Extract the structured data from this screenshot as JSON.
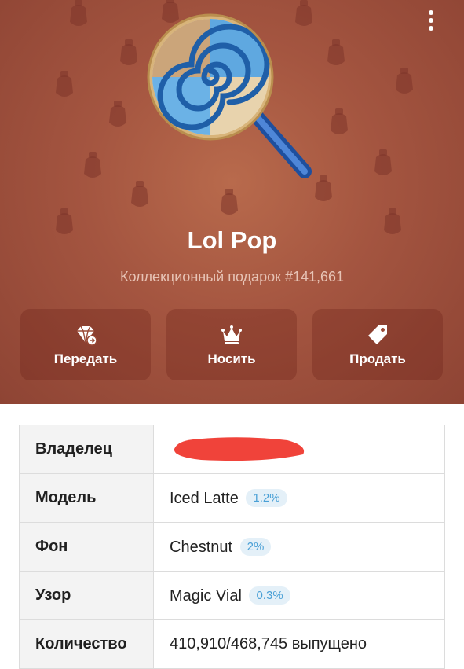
{
  "header": {
    "title": "Lol Pop",
    "subtitle": "Коллекционный подарок #141,661",
    "background_color": "#a45540",
    "gift_icon": "lollipop-icon",
    "pattern_icon": "vial-icon",
    "menu_icon": "more-vertical-icon"
  },
  "actions": [
    {
      "label": "Передать",
      "icon": "diamond-transfer-icon"
    },
    {
      "label": "Носить",
      "icon": "crown-icon"
    },
    {
      "label": "Продать",
      "icon": "price-tag-icon"
    }
  ],
  "details": {
    "owner": {
      "label": "Владелец",
      "value_redacted": true
    },
    "model": {
      "label": "Модель",
      "value": "Iced Latte",
      "badge": "1.2%"
    },
    "backdrop": {
      "label": "Фон",
      "value": "Chestnut",
      "badge": "2%"
    },
    "symbol": {
      "label": "Узор",
      "value": "Magic Vial",
      "badge": "0.3%"
    },
    "quantity": {
      "label": "Количество",
      "value": "410,910/468,745 выпущено"
    }
  },
  "colors": {
    "badge_text": "#4aa0d6",
    "badge_bg": "#e4f0f8",
    "redaction": "#f0433a"
  }
}
